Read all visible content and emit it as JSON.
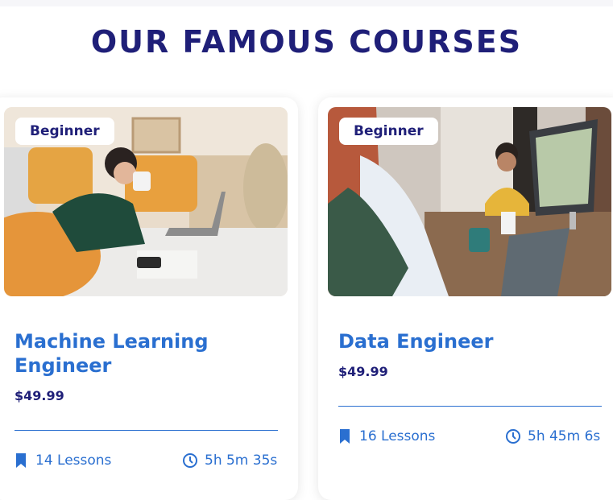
{
  "section": {
    "title": "OUR FAMOUS COURSES"
  },
  "courses": [
    {
      "level": "Beginner",
      "title_line1": "Machine Learning",
      "title_line2": "Engineer",
      "price": "$49.99",
      "lessons": "14 Lessons",
      "duration": "5h 5m 35s",
      "image": "woman-with-laptop-on-bed-photo"
    },
    {
      "level": "Beginner",
      "title_line1": "Data Engineer",
      "price": "$49.99",
      "lessons": "16 Lessons",
      "duration": "5h 45m 6s",
      "image": "team-working-at-table-photo"
    }
  ],
  "colors": {
    "heading": "#1f1f78",
    "accent": "#2a6fd0",
    "price": "#1f1f78"
  },
  "icons": {
    "lessons": "bookmark-icon",
    "duration": "clock-icon"
  }
}
